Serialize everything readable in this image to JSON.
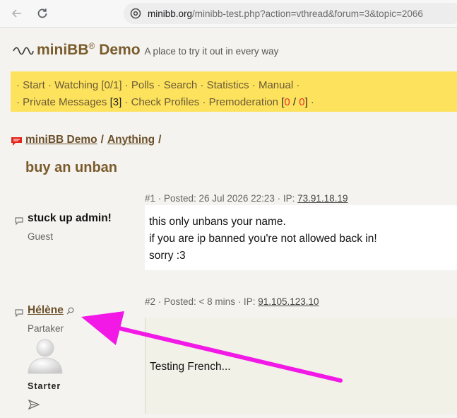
{
  "browser": {
    "url_host": "minibb.org",
    "url_path": "/minibb-test.php?action=vthread&forum=3&topic=2066"
  },
  "header": {
    "title": "miniBB",
    "reg_mark": "®",
    "title_suffix": "Demo",
    "tagline": "A place to try it out in every way"
  },
  "menu": {
    "row1": {
      "lead": "· ",
      "start": "Start",
      "sep": " · ",
      "watching": "Watching [0/1]",
      "polls": "Polls",
      "search": "Search",
      "statistics": "Statistics",
      "manual": "Manual",
      "trail": " ·"
    },
    "row2": {
      "lead": "· ",
      "pm": "Private Messages ",
      "pm_count": "[3]",
      "sep": " · ",
      "check_profiles": "Check Profiles",
      "premod": "Premoderation ",
      "premod_open": "[",
      "premod_a": "0",
      "premod_slash": " / ",
      "premod_b": "0",
      "premod_close": "]",
      "trail": " ·"
    }
  },
  "breadcrumb": {
    "home": "miniBB Demo",
    "sep": "/",
    "forum": "Anything",
    "trail": "/"
  },
  "topic": {
    "title": "buy an unban"
  },
  "posts": [
    {
      "meta": "#1 · Posted: 26 Jul 2026 22:23 · IP: ",
      "ip": "73.91.18.19",
      "author": "stuck up admin!",
      "role": "Guest",
      "lines": [
        "this only unbans your name.",
        "if you are ip banned you're not allowed back in!",
        "sorry :3"
      ]
    },
    {
      "meta": "#2 · Posted: < 8 mins · IP: ",
      "ip": "91.105.123.10",
      "author": "Hélène",
      "role": "Partaker",
      "rank": "Starter",
      "text": "Testing French..."
    }
  ],
  "colors": {
    "menu_bg": "#fde25d",
    "brand_brown": "#7a5b2c",
    "annotation_arrow": "#f218e6",
    "counter_red": "#e8322a"
  }
}
